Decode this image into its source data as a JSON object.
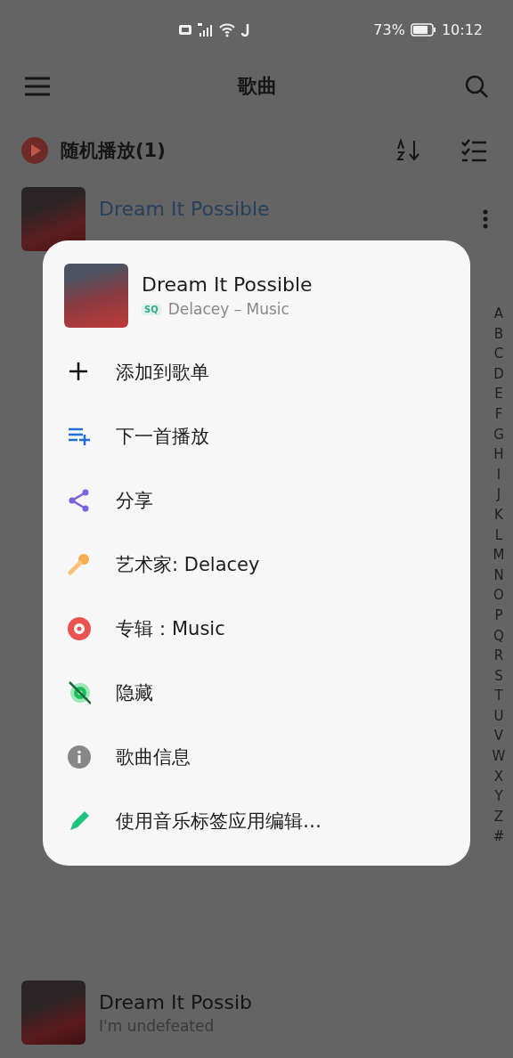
{
  "status_bar": {
    "battery": "73%",
    "time": "10:12"
  },
  "app_bar": {
    "title": "歌曲"
  },
  "shuffle": {
    "label": "随机播放(1)"
  },
  "songs": [
    {
      "title": "Dream It Possible",
      "playing": true
    }
  ],
  "index_letters": [
    "A",
    "B",
    "C",
    "D",
    "E",
    "F",
    "G",
    "H",
    "I",
    "J",
    "K",
    "L",
    "M",
    "N",
    "O",
    "P",
    "Q",
    "R",
    "S",
    "T",
    "U",
    "V",
    "W",
    "X",
    "Y",
    "Z",
    "#"
  ],
  "sheet": {
    "title": "Dream It Possible",
    "quality": "SQ",
    "subtitle": "Delacey – Music",
    "actions": [
      {
        "kind": "add",
        "label": "添加到歌单"
      },
      {
        "kind": "queue",
        "label": "下一首播放"
      },
      {
        "kind": "share",
        "label": "分享"
      },
      {
        "kind": "artist",
        "label": "艺术家: Delacey"
      },
      {
        "kind": "album",
        "label": "专辑：Music"
      },
      {
        "kind": "hide",
        "label": "隐藏"
      },
      {
        "kind": "info",
        "label": "歌曲信息"
      },
      {
        "kind": "edit",
        "label": "使用音乐标签应用编辑…"
      }
    ]
  },
  "mini_player": {
    "title": "Dream It Possib",
    "subtitle": "I'm undefeated"
  }
}
